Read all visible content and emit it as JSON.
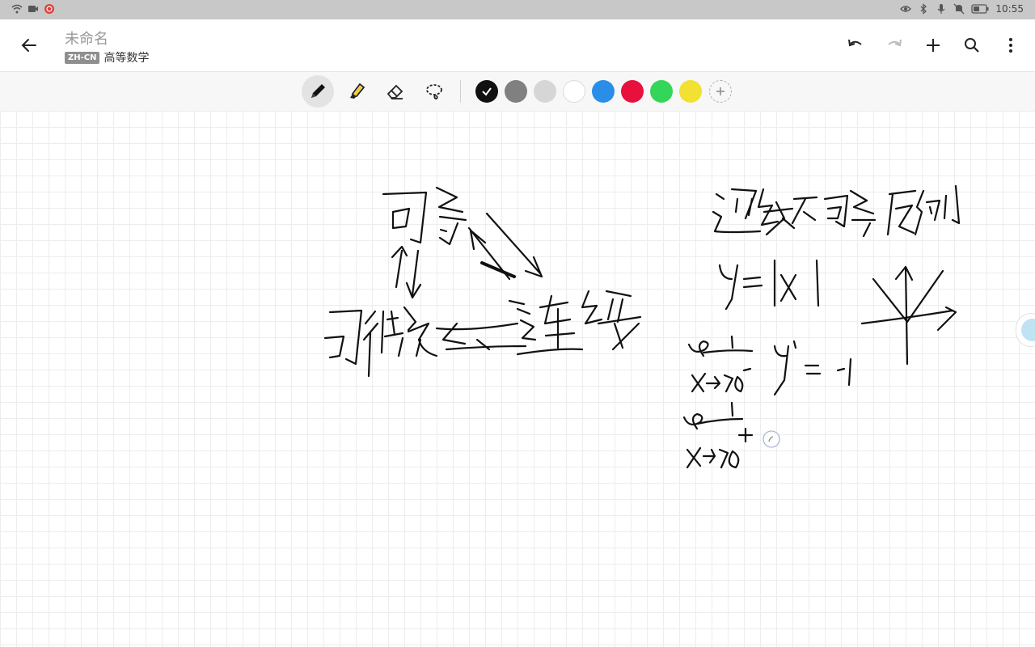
{
  "status_bar": {
    "time": "10:55"
  },
  "app_bar": {
    "title": "未命名",
    "language_badge": "ZH-CN",
    "notebook": "高等数学",
    "icons": [
      "back-arrow-icon",
      "undo-icon",
      "redo-icon",
      "add-icon",
      "search-icon",
      "more-vert-icon"
    ]
  },
  "toolbar": {
    "tools": [
      "pen",
      "highlighter",
      "eraser",
      "lasso"
    ],
    "active_tool": "pen",
    "colors": [
      "#111111",
      "#808080",
      "#d6d6d6",
      "#ffffff",
      "#2a8ee8",
      "#e8103c",
      "#33d659",
      "#f2e033"
    ],
    "selected_color": "#111111"
  },
  "colors": {
    "status_bar_bg": "#c8c8c8",
    "toolbar_bg": "#f7f7f7",
    "ink": "#111111"
  }
}
